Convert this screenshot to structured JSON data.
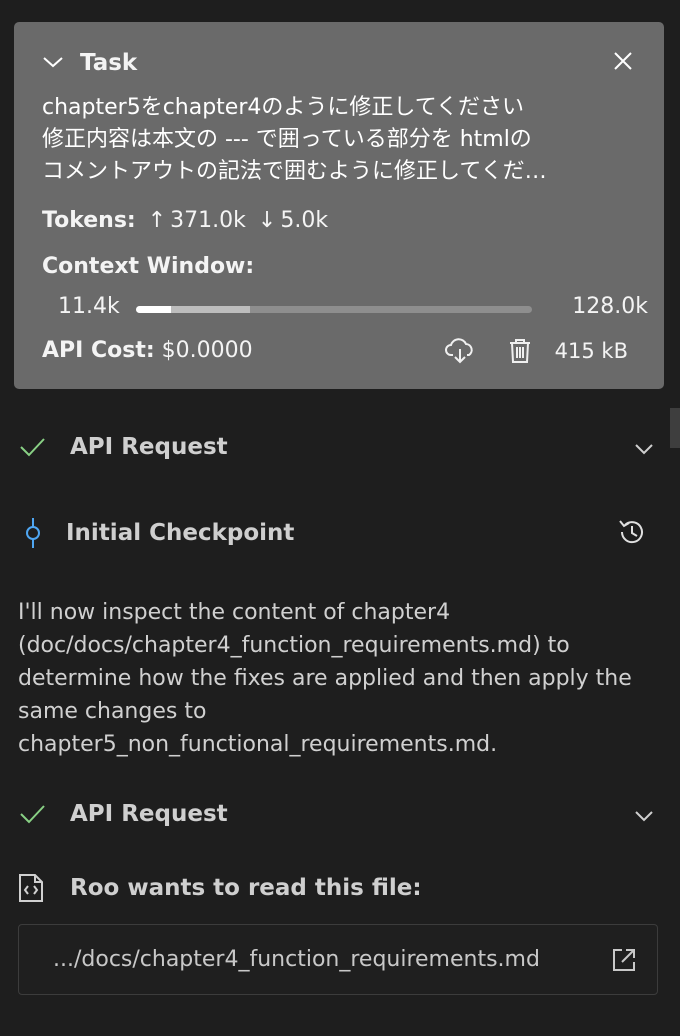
{
  "task": {
    "title": "Task",
    "text_lines": [
      "chapter5をchapter4のように修正してください",
      "修正内容は本文の --- で囲っている部分を htmlの",
      "コメントアウトの記法で囲むように修正してくだ…"
    ],
    "tokens_label": "Tokens:",
    "tokens_up": "371.0k",
    "tokens_down": "5.0k",
    "context_label": "Context Window:",
    "context_used": "11.4k",
    "context_max": "128.0k",
    "context_used_fraction": 0.089,
    "context_reserved_fraction": 0.2,
    "api_cost_label": "API Cost:",
    "api_cost_value": "$0.0000",
    "size": "415 kB"
  },
  "rows": {
    "api_request_1": "API Request",
    "checkpoint": "Initial Checkpoint",
    "api_request_2": "API Request",
    "read_file": "Roo wants to read this file:"
  },
  "message": "I'll now inspect the content of chapter4 (doc/docs/chapter4_function_requirements.md) to determine how the fixes are applied and then apply the same changes to chapter5_non_functional_requirements.md.",
  "file_path": ".../docs/chapter4_function_requirements.md",
  "icons": {
    "collapse": "chevron-down-icon",
    "close": "close-icon",
    "download": "cloud-download-icon",
    "delete": "trash-icon",
    "success": "check-icon",
    "checkpoint": "git-commit-icon",
    "history": "history-icon",
    "file": "file-code-icon",
    "open_external": "link-external-icon"
  },
  "colors": {
    "card": "#6a6a6a",
    "check": "#89d185",
    "checkpoint": "#4fa6f2",
    "background": "#1e1e1e"
  }
}
